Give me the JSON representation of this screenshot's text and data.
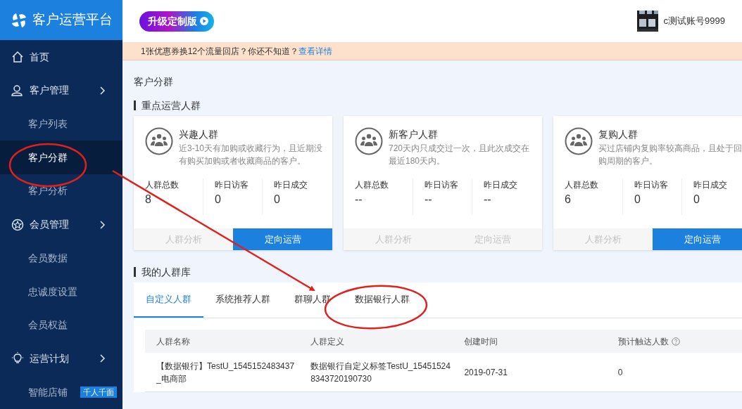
{
  "app": {
    "title": "客户运营平台"
  },
  "sidebar": {
    "items": [
      {
        "label": "首页",
        "kind": "link",
        "selected": false
      },
      {
        "label": "客户管理",
        "kind": "group",
        "selected": false
      },
      {
        "label": "客户列表",
        "kind": "sub",
        "selected": false
      },
      {
        "label": "客户分群",
        "kind": "sub",
        "selected": true
      },
      {
        "label": "客户分析",
        "kind": "sub",
        "selected": false
      },
      {
        "label": "会员管理",
        "kind": "group",
        "selected": false
      },
      {
        "label": "会员数据",
        "kind": "sub",
        "selected": false
      },
      {
        "label": "忠诚度设置",
        "kind": "sub",
        "selected": false
      },
      {
        "label": "会员权益",
        "kind": "sub",
        "selected": false
      },
      {
        "label": "运营计划",
        "kind": "group",
        "selected": false
      },
      {
        "label": "智能店铺",
        "kind": "sub",
        "selected": false,
        "badge": "千人千面"
      }
    ]
  },
  "header": {
    "upgrade_button": "升级定制版",
    "user": {
      "name": "c测试账号9999"
    }
  },
  "notice": {
    "text": "1张优惠券换12个流量回店？你还不知道？",
    "link": "查看详情"
  },
  "page_title": "客户分群",
  "key_segments": {
    "title": "重点运营人群",
    "cards": [
      {
        "title": "兴趣人群",
        "description": "近3-10天有加购或收藏行为，且近期没有购买加购或者收藏商品的客户。",
        "stats": [
          {
            "label": "人群总数",
            "value": "8"
          },
          {
            "label": "昨日访客",
            "value": "0"
          },
          {
            "label": "昨日成交",
            "value": "0"
          }
        ],
        "actions": [
          {
            "label": "人群分析",
            "primary": false
          },
          {
            "label": "定向运营",
            "primary": true
          }
        ]
      },
      {
        "title": "新客户人群",
        "description": "720天内只成交过一次，且此次成交在最近180天内。",
        "stats": [
          {
            "label": "人群总数",
            "value": "--"
          },
          {
            "label": "昨日访客",
            "value": "--"
          },
          {
            "label": "昨日成交",
            "value": "--"
          }
        ],
        "actions": [
          {
            "label": "人群分析",
            "primary": false
          },
          {
            "label": "定向运营",
            "primary": false
          }
        ]
      },
      {
        "title": "复购人群",
        "description": "买过店铺内复购率较高商品，且处于回购周期的客户。",
        "stats": [
          {
            "label": "人群总数",
            "value": "6"
          },
          {
            "label": "昨日访客",
            "value": "0"
          },
          {
            "label": "昨日成交",
            "value": "0"
          }
        ],
        "actions": [
          {
            "label": "人群分析",
            "primary": false
          },
          {
            "label": "定向运营",
            "primary": true
          }
        ]
      }
    ]
  },
  "library": {
    "title": "我的人群库",
    "tabs": [
      {
        "label": "自定义人群",
        "selected": true
      },
      {
        "label": "系统推荐人群",
        "selected": false
      },
      {
        "label": "群聊人群",
        "selected": false
      },
      {
        "label": "数据银行人群",
        "selected": false
      }
    ],
    "table": {
      "columns": [
        {
          "label": "人群名称",
          "help": false
        },
        {
          "label": "人群定义",
          "help": false
        },
        {
          "label": "创建时间",
          "help": false
        },
        {
          "label": "预计触达人数",
          "help": true
        }
      ],
      "rows": [
        [
          "【数据银行】TestU_1545152483437_电商部",
          "数据银行自定义标签TestU_154515248343720190730",
          "2019-07-31",
          "0"
        ]
      ]
    }
  }
}
